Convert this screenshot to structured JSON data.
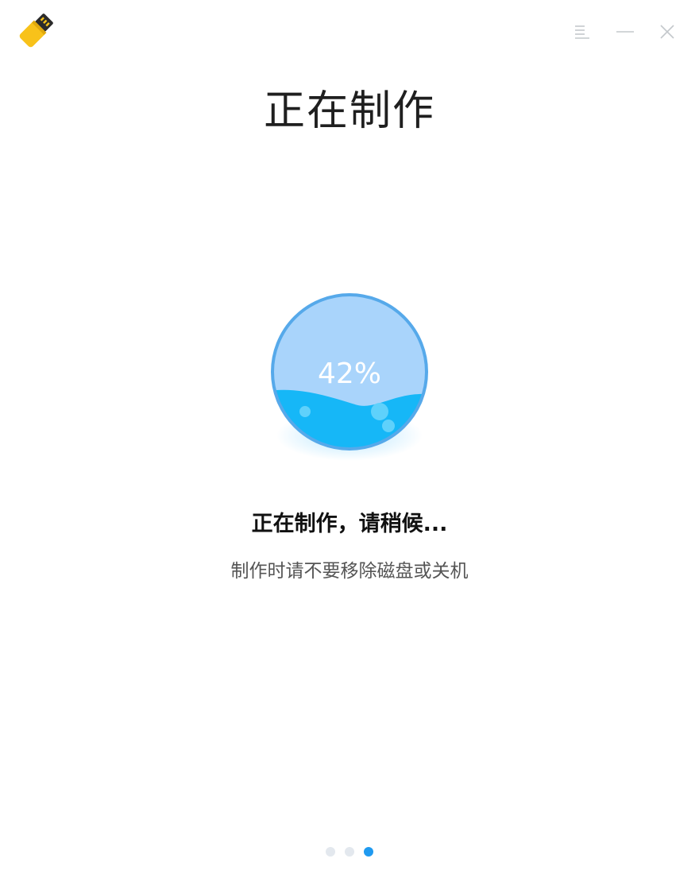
{
  "window": {
    "icons": {
      "app": "usb-drive-icon",
      "menu": "menu-icon",
      "minimize": "minimize-icon",
      "close": "close-icon"
    }
  },
  "main": {
    "title": "正在制作",
    "progress": {
      "value": 42,
      "label": "42%"
    },
    "status": "正在制作，请稍候...",
    "hint": "制作时请不要移除磁盘或关机"
  },
  "pager": {
    "count": 3,
    "active_index": 2
  },
  "colors": {
    "accent": "#1f9af0",
    "water": "#16b7f7",
    "globe_light": "#a9d4fb",
    "ring": "#56a9ea",
    "title_text": "#1f1f1f",
    "hint_text": "#555555",
    "dot_inactive": "#e3e8ee",
    "icon_yellow": "#f8c21a"
  }
}
